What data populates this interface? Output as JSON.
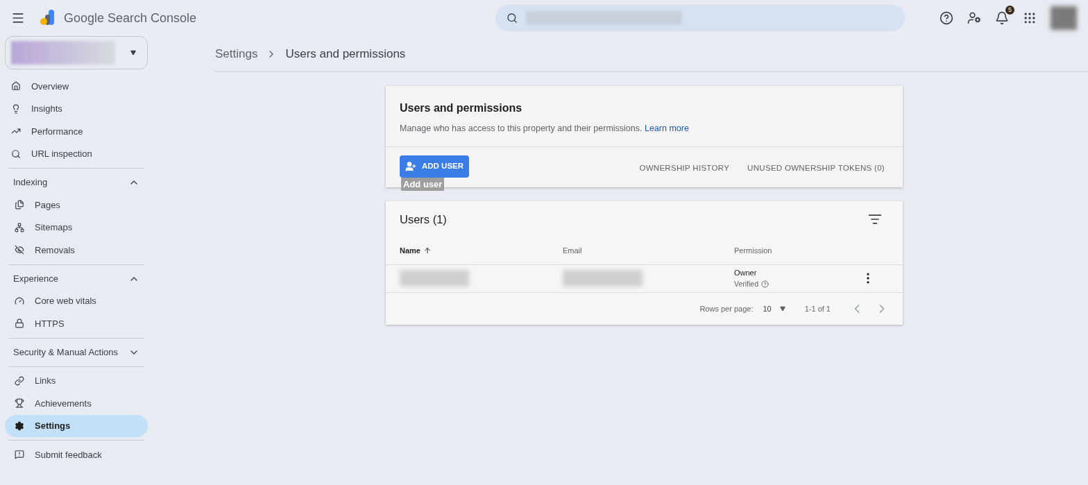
{
  "header": {
    "title": "Google Search Console",
    "notifications": "5"
  },
  "sidebar": {
    "groups": [
      {
        "items": [
          {
            "label": "Overview",
            "selected": false
          },
          {
            "label": "Insights",
            "selected": false
          },
          {
            "label": "Performance",
            "selected": false
          },
          {
            "label": "URL inspection",
            "selected": false
          }
        ]
      },
      {
        "heading": "Indexing",
        "expanded": true,
        "items": [
          {
            "label": "Pages",
            "selected": false
          },
          {
            "label": "Sitemaps",
            "selected": false
          },
          {
            "label": "Removals",
            "selected": false
          }
        ]
      },
      {
        "heading": "Experience",
        "expanded": true,
        "items": [
          {
            "label": "Core web vitals",
            "selected": false
          },
          {
            "label": "HTTPS",
            "selected": false
          }
        ]
      },
      {
        "heading": "Security & Manual Actions",
        "expanded": false
      },
      {
        "items": [
          {
            "label": "Links",
            "selected": false
          },
          {
            "label": "Achievements",
            "selected": false
          },
          {
            "label": "Settings",
            "selected": true
          }
        ]
      },
      {
        "items": [
          {
            "label": "Submit feedback",
            "selected": false
          }
        ]
      }
    ]
  },
  "breadcrumbs": [
    "Settings",
    "Users and permissions"
  ],
  "card": {
    "title": "Users and permissions",
    "description": "Manage who has access to this property and their permissions.",
    "link": "Learn more",
    "add_button": "ADD USER",
    "dialog_title": "Add user",
    "tabs": [
      "OWNERSHIP HISTORY",
      "UNUSED OWNERSHIP TOKENS (0)"
    ]
  },
  "users": {
    "title": "Users (1)",
    "columns": [
      "Name",
      "Email",
      "Permission"
    ],
    "rows": [
      {
        "permission": "Owner",
        "status": "Verified"
      }
    ],
    "rows_per_page_label": "Rows per page:",
    "rows_per_page": "10",
    "range": "1-1 of 1"
  }
}
